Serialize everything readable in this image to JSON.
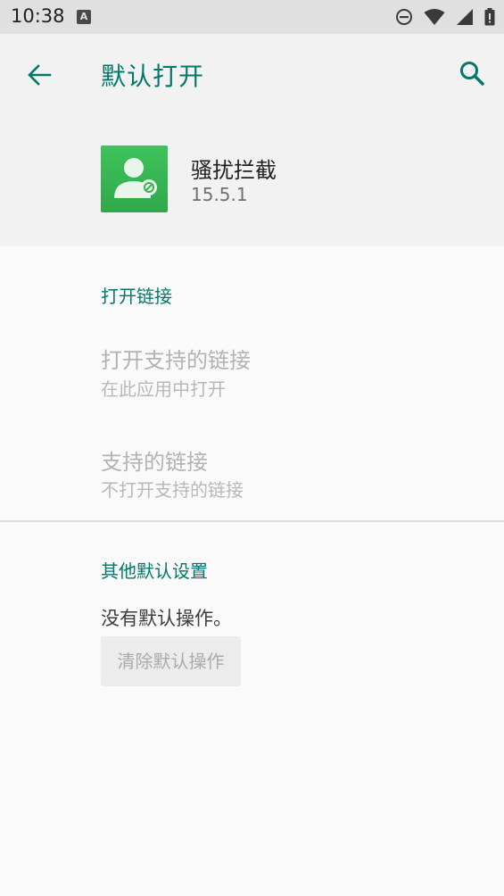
{
  "status_bar": {
    "time": "10:38",
    "notification_icon": "A",
    "icons": [
      "a-notification-icon",
      "do-not-disturb-icon",
      "wifi-icon",
      "cellular-signal-icon",
      "battery-icon"
    ]
  },
  "toolbar": {
    "title": "默认打开",
    "back_icon": "arrow-back-icon",
    "search_icon": "search-icon"
  },
  "app": {
    "name": "骚扰拦截",
    "version": "15.5.1",
    "icon": "user-blocked-icon"
  },
  "open_links": {
    "section_title": "打开链接",
    "items": [
      {
        "title": "打开支持的链接",
        "summary": "在此应用中打开"
      },
      {
        "title": "支持的链接",
        "summary": "不打开支持的链接"
      }
    ]
  },
  "other_defaults": {
    "section_title": "其他默认设置",
    "message": "没有默认操作。",
    "clear_button_label": "清除默认操作"
  },
  "colors": {
    "accent": "#00796b",
    "status_bar_bg": "#e0e0e0",
    "header_bg": "#f2f2f2",
    "page_bg": "#fafafa",
    "app_icon_green": "#35b552"
  }
}
